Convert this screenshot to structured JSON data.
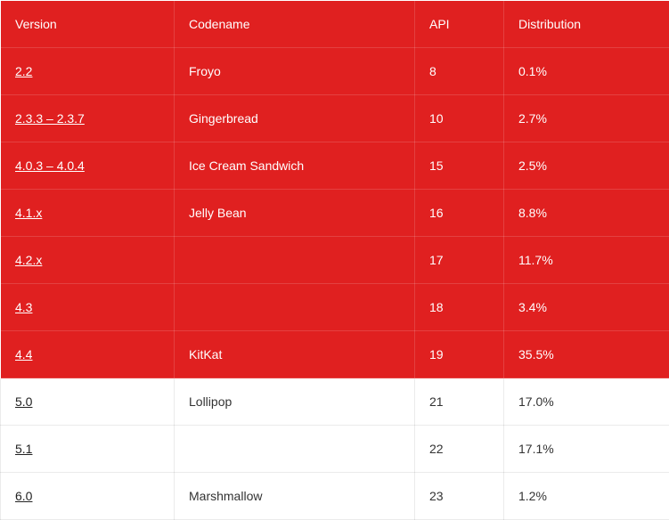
{
  "table": {
    "headers": {
      "version": "Version",
      "codename": "Codename",
      "api": "API",
      "distribution": "Distribution"
    },
    "rows": [
      {
        "version": "2.2",
        "codename": "Froyo",
        "api": "8",
        "distribution": "0.1%",
        "highlight": true
      },
      {
        "version": "2.3.3 – 2.3.7",
        "codename": "Gingerbread",
        "api": "10",
        "distribution": "2.7%",
        "highlight": true
      },
      {
        "version": "4.0.3 – 4.0.4",
        "codename": "Ice Cream Sandwich",
        "api": "15",
        "distribution": "2.5%",
        "highlight": true
      },
      {
        "version": "4.1.x",
        "codename": "Jelly Bean",
        "api": "16",
        "distribution": "8.8%",
        "highlight": true
      },
      {
        "version": "4.2.x",
        "codename": "",
        "api": "17",
        "distribution": "11.7%",
        "highlight": true
      },
      {
        "version": "4.3",
        "codename": "",
        "api": "18",
        "distribution": "3.4%",
        "highlight": true
      },
      {
        "version": "4.4",
        "codename": "KitKat",
        "api": "19",
        "distribution": "35.5%",
        "highlight": true
      },
      {
        "version": "5.0",
        "codename": "Lollipop",
        "api": "21",
        "distribution": "17.0%",
        "highlight": false
      },
      {
        "version": "5.1",
        "codename": "",
        "api": "22",
        "distribution": "17.1%",
        "highlight": false
      },
      {
        "version": "6.0",
        "codename": "Marshmallow",
        "api": "23",
        "distribution": "1.2%",
        "highlight": false
      }
    ]
  }
}
